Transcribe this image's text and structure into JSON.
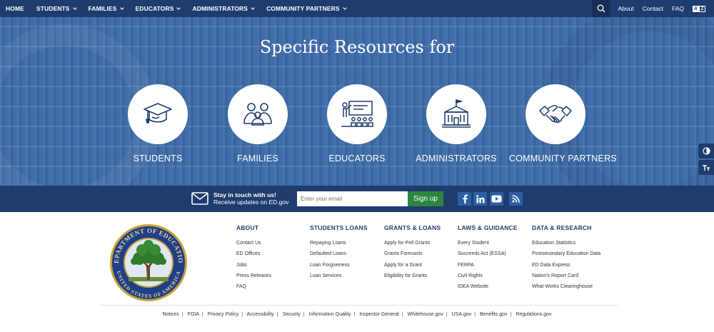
{
  "nav": {
    "items": [
      {
        "label": "HOME",
        "dropdown": false
      },
      {
        "label": "STUDENTS",
        "dropdown": true
      },
      {
        "label": "FAMILIES",
        "dropdown": true
      },
      {
        "label": "EDUCATORS",
        "dropdown": true
      },
      {
        "label": "ADMINISTRATORS",
        "dropdown": true
      },
      {
        "label": "COMMUNITY PARTNERS",
        "dropdown": true
      }
    ],
    "search_icon": "search-icon",
    "utility": [
      "About",
      "Contact",
      "FAQ"
    ],
    "translate": {
      "a": "A",
      "b": "Z"
    }
  },
  "hero": {
    "title": "Specific Resources for",
    "cards": [
      {
        "label": "STUDENTS",
        "icon": "graduation-cap-icon"
      },
      {
        "label": "FAMILIES",
        "icon": "family-icon"
      },
      {
        "label": "EDUCATORS",
        "icon": "teacher-icon"
      },
      {
        "label": "ADMINISTRATORS",
        "icon": "building-icon"
      },
      {
        "label": "COMMUNITY PARTNERS",
        "icon": "handshake-icon"
      }
    ]
  },
  "side_tools": [
    "contrast-icon",
    "text-size-icon"
  ],
  "subscribe": {
    "heading": "Stay in touch with us!",
    "subtext": "Receive updates on ED.gov",
    "placeholder": "Enter your email",
    "button": "Sign up",
    "social": [
      "facebook-icon",
      "linkedin-icon",
      "youtube-icon",
      "rss-icon"
    ]
  },
  "footer": {
    "columns": [
      {
        "heading": "ABOUT",
        "items": [
          "Contact Us",
          "ED Offices",
          "Jobs",
          "Press Releases",
          "FAQ"
        ]
      },
      {
        "heading": "STUDENTS LOANS",
        "items": [
          "Repaying Loans",
          "Defaulted Loans",
          "Loan Forgiveness",
          "Loan Services"
        ]
      },
      {
        "heading": "GRANTS & LOANS",
        "items": [
          "Apply for Pell Grants",
          "Grants Forecasts",
          "Apply for a Grant",
          "Eligibility for Grants"
        ]
      },
      {
        "heading": "LAWS & GUIDANCE",
        "items": [
          "Every Student",
          "Succeeds Act (ESSA)",
          "FERPA",
          "Civil Rights",
          "IDEA Website"
        ]
      },
      {
        "heading": "DATA & RESEARCH",
        "items": [
          "Education Statistics",
          "Postsecondary Education Data",
          "ED Data Express",
          "Nation's Report Card",
          "What Works Clearinghouse"
        ]
      }
    ],
    "seal_text_top": "DEPARTMENT OF EDUCATION",
    "seal_text_bottom": "UNITED STATES OF AMERICA",
    "bottom_links": [
      "Notices",
      "FOIA",
      "Privacy Policy",
      "Accessibility",
      "Security",
      "Information Quality",
      "Inspector General",
      "Whitehouse.gov",
      "USA.gov",
      "Benefits.gov",
      "Regulations.gov"
    ]
  },
  "colors": {
    "navy": "#1f3c6e",
    "hero_blue": "#3d6aa8",
    "signup_green": "#2e8540",
    "social_blue": "#2b5fa3"
  }
}
